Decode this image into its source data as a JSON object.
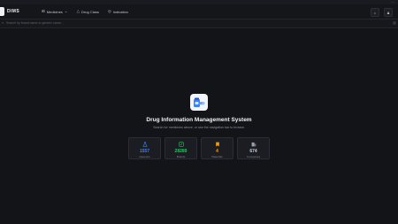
{
  "window": {
    "controls": "···"
  },
  "brand": {
    "name": "DIMS"
  },
  "nav": {
    "items": [
      {
        "icon": "medicine-icon",
        "label": "Medicines",
        "has_dropdown": true
      },
      {
        "icon": "drug-class-icon",
        "label": "Drug Class"
      },
      {
        "icon": "indication-icon",
        "label": "Indication"
      }
    ]
  },
  "search": {
    "placeholder": "Search by brand name or generic name..."
  },
  "hero": {
    "title": "Drug Information Management System",
    "subtitle": "Search for medicines above, or use the navigation bar to browse."
  },
  "stats": [
    {
      "value": "1557",
      "label": "Generics",
      "icon": "flask-icon",
      "color": "#3b82f6"
    },
    {
      "value": "28289",
      "label": "Brands",
      "icon": "pills-icon",
      "color": "#22c55e"
    },
    {
      "value": "4",
      "label": "Materials",
      "icon": "bookmark-icon",
      "color": "#f59e0b"
    },
    {
      "value": "674",
      "label": "Companies",
      "icon": "building-icon",
      "color": "#9ca3af"
    }
  ]
}
